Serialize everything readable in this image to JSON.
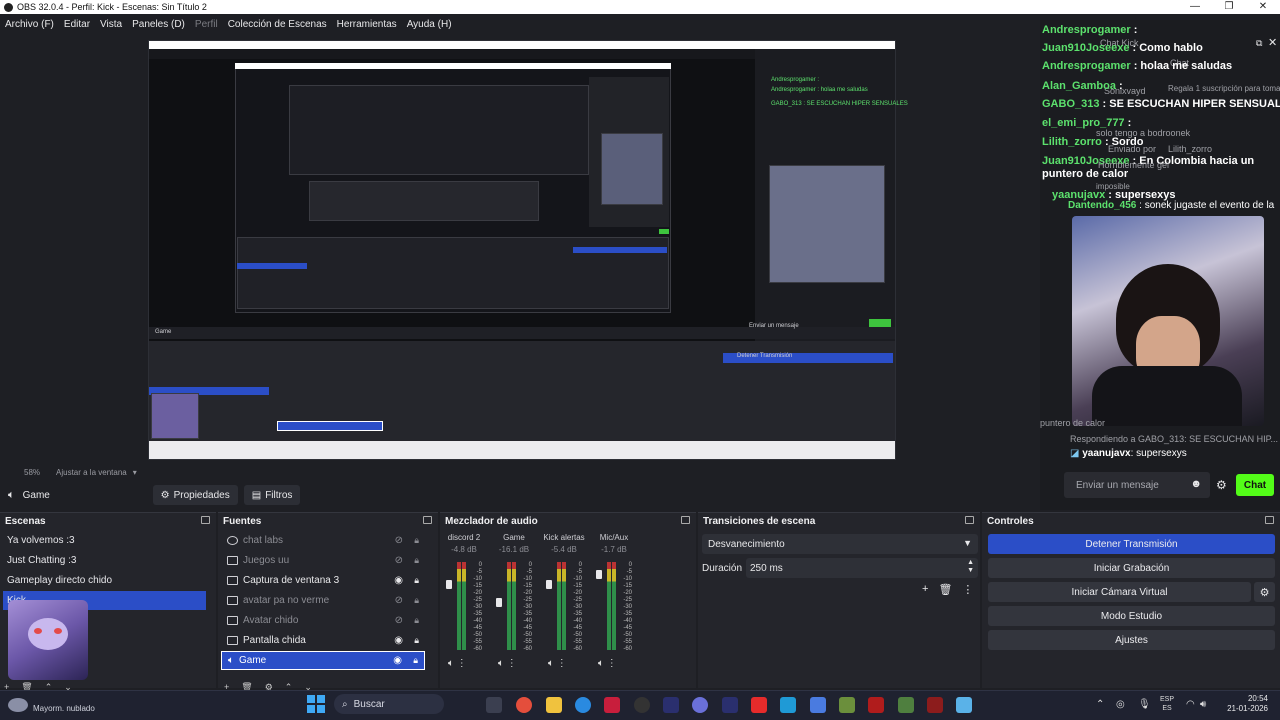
{
  "window": {
    "title": "OBS 32.0.4 - Perfil: Kick - Escenas: Sin Título 2",
    "controls": [
      "—",
      "❐",
      "✕"
    ]
  },
  "menu": [
    "Archivo (F)",
    "Editar",
    "Vista",
    "Paneles (D)",
    "Perfil",
    "Colección de Escenas",
    "Herramientas",
    "Ayuda (H)"
  ],
  "preview_footer": {
    "zoom": "58%",
    "fit": "Ajustar a la ventana"
  },
  "source_toolbar": {
    "source": "Game",
    "properties": "Propiedades",
    "filters": "Filtros"
  },
  "scenes": {
    "title": "Escenas",
    "items": [
      "Ya volvemos :3",
      "Just Chatting :3",
      "Gameplay directo chido",
      "Kick"
    ],
    "selected": 3
  },
  "sources": {
    "title": "Fuentes",
    "items": [
      {
        "label": "chat labs",
        "hidden": true
      },
      {
        "label": "Juegos uu",
        "hidden": true
      },
      {
        "label": "Captura de ventana 3",
        "hidden": false
      },
      {
        "label": "avatar pa no verme",
        "hidden": true
      },
      {
        "label": "Avatar chido",
        "hidden": true
      },
      {
        "label": "Pantalla chida",
        "hidden": false
      },
      {
        "label": "Game",
        "hidden": false,
        "selected": true
      }
    ]
  },
  "mixer": {
    "title": "Mezclador de audio",
    "channels": [
      {
        "name": "discord 2",
        "db": "-4.8 dB"
      },
      {
        "name": "Game",
        "db": "-16.1 dB"
      },
      {
        "name": "Kick alertas",
        "db": "-5.4 dB"
      },
      {
        "name": "Mic/Aux",
        "db": "-1.7 dB"
      }
    ],
    "scale": [
      "0",
      "-5",
      "-10",
      "-15",
      "-20",
      "-25",
      "-30",
      "-35",
      "-40",
      "-45",
      "-50",
      "-55",
      "-60"
    ]
  },
  "transitions": {
    "title": "Transiciones de escena",
    "selected": "Desvanecimiento",
    "duration_label": "Duración",
    "duration_value": "250 ms"
  },
  "controls": {
    "title": "Controles",
    "buttons": [
      "Detener Transmisión",
      "Iniciar Grabación",
      "Iniciar Cámara Virtual",
      "Modo Estudio",
      "Ajustes"
    ]
  },
  "chat": {
    "lines": [
      {
        "user": "Andresprogamer",
        "msg": ":"
      },
      {
        "user": "Juan910Joseexe",
        "msg": ": Como hablo"
      },
      {
        "user": "Andresprogamer",
        "msg": ": holaa me saludas"
      },
      {
        "user": "Alan_Gamboa",
        "msg": ":"
      },
      {
        "user": "GABO_313",
        "msg": ": SE ESCUCHAN HIPER SENSUALES"
      },
      {
        "user": "el_emi_pro_777",
        "msg": ":"
      },
      {
        "user": "Lilith_zorro",
        "msg": ": Sordo"
      },
      {
        "user": "Juan910Joseexe",
        "msg": ": En Colombia hacia un puntero de calor"
      },
      {
        "user": "yaanujavx",
        "msg": ": supersexys"
      },
      {
        "user": "Dantendo_456",
        "msg": ": sonek jugaste el evento de la"
      }
    ],
    "faint": [
      "Chat Kick",
      "Chat",
      "Sonixvayd",
      "Regala 1 suscripción para tomar la pocion",
      "solo tengo a bodroonek",
      "Enviado por",
      "Lilith_zorro",
      "Horriblemente gei",
      "imposible",
      "Respondiendo a GABO_313: SE ESCUCHAN HIP...",
      "puntero de calor"
    ],
    "reply_user": "yaanujavx",
    "reply_msg": "supersexys",
    "input_placeholder": "Enviar un mensaje",
    "send": "Chat"
  },
  "taskbar": {
    "search": "Buscar",
    "weather": "Mayorm. nublado",
    "lang": "ESP",
    "lang2": "ES",
    "time": "20:54",
    "date": "21-01-2026"
  }
}
